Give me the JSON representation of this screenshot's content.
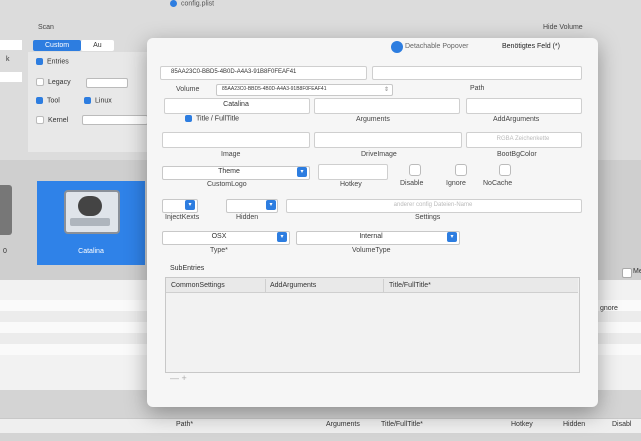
{
  "background": {
    "top_fragment": "config.plist",
    "scan_label": "Scan",
    "hide_volume_label": "Hide Volume",
    "segmented": [
      "Custom",
      "Au"
    ],
    "left_left_letter": "k",
    "checkboxes": [
      {
        "label": "Entries",
        "checked": true
      },
      {
        "label": "Legacy",
        "checked": false
      },
      {
        "label": "Tool",
        "checked": true
      },
      {
        "label": "Linux",
        "checked": true
      },
      {
        "label": "Kernel",
        "checked": false
      }
    ],
    "card_label": "Catalina",
    "left_edge_text": "0",
    "right_ignore": "gnore",
    "right_me": "Me",
    "bottom_headers": [
      "Path*",
      "Arguments",
      "Title/FullTitle*",
      "Hotkey",
      "Hidden",
      "Disabl"
    ]
  },
  "popover": {
    "title": "Detachable Popover",
    "required_note": "Benötigtes Feld (*)",
    "uuid_value": "85AA23C0-BBD5-4B0D-A4A3-91B8F0FEAF41",
    "volume_label": "Volume",
    "volume_value": "85AA23C0-BBD5-4B0D-A4A3-91B8F0FEAF41",
    "path_label": "Path",
    "title_value": "Catalina",
    "title_checkbox_label": "Title / FullTitle",
    "arguments_label": "Arguments",
    "add_arguments_label": "AddArguments",
    "image_label": "Image",
    "drive_image_label": "DriveImage",
    "bg_color_placeholder": "RGBA Zeichenkette",
    "bg_color_label": "BootBgColor",
    "custom_logo_value": "Theme",
    "custom_logo_label": "CustomLogo",
    "hotkey_label": "Hotkey",
    "disable_label": "Disable",
    "ignore_label": "Ignore",
    "nocache_label": "NoCache",
    "inject_kexts_label": "InjectKexts",
    "hidden_label": "Hidden",
    "settings_placeholder": "anderer config Dateien-Name",
    "settings_label": "Settings",
    "type_value": "OSX",
    "type_label": "Type*",
    "volume_type_value": "Internal",
    "volume_type_label": "VolumeType",
    "subentries_label": "SubEntries",
    "subentries_columns": [
      "CommonSettings",
      "AddArguments",
      "Title/FullTitle*"
    ],
    "add_remove": "— +"
  },
  "colors": {
    "accent": "#2d7de0",
    "card": "#2f82e8"
  }
}
